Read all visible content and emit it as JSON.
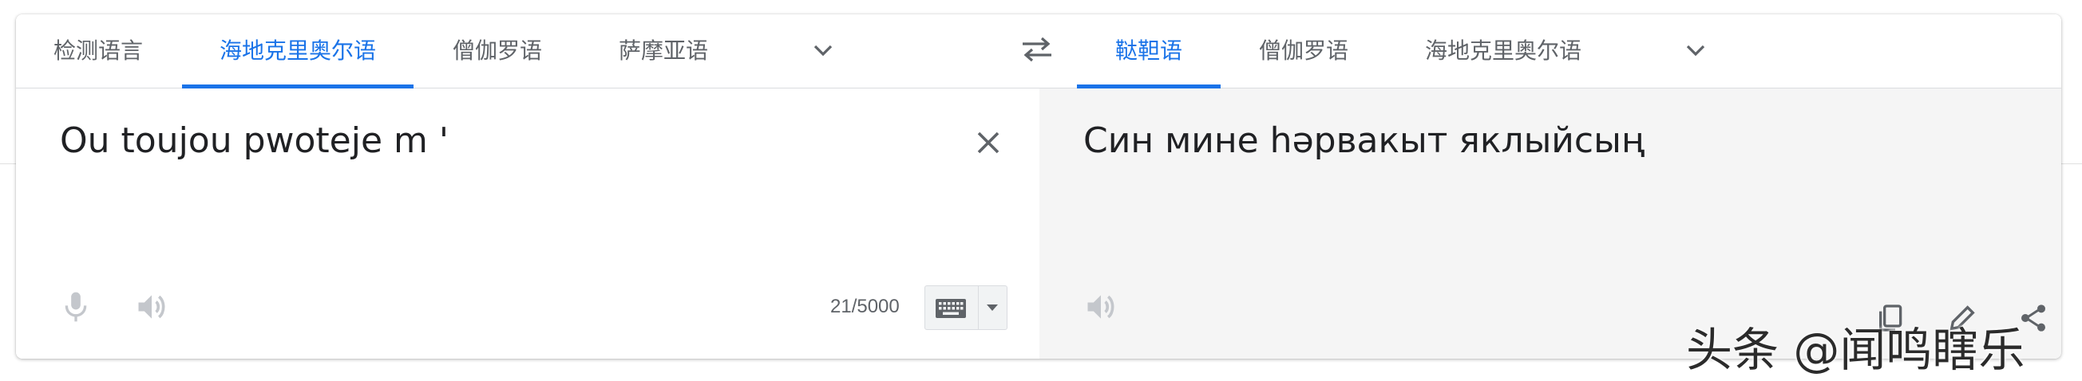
{
  "source_tabs": [
    {
      "label": "检测语言",
      "active": false
    },
    {
      "label": "海地克里奥尔语",
      "active": true
    },
    {
      "label": "僧伽罗语",
      "active": false
    },
    {
      "label": "萨摩亚语",
      "active": false
    }
  ],
  "target_tabs": [
    {
      "label": "鞑靼语",
      "active": true
    },
    {
      "label": "僧伽罗语",
      "active": false
    },
    {
      "label": "海地克里奥尔语",
      "active": false
    }
  ],
  "source": {
    "text": "Ou toujou pwoteje m '",
    "char_count": "21/5000"
  },
  "target": {
    "text": "Син мине һәрвакыт яклыйсың"
  },
  "watermark": "头条 @闻鸣瞎乐",
  "colors": {
    "accent": "#1a73e8",
    "target_bg": "#f5f5f5",
    "icon_gray": "#5f6368"
  },
  "icons": [
    "swap-languages-icon",
    "chevron-down-icon",
    "close-icon",
    "microphone-icon",
    "speaker-icon",
    "keyboard-icon",
    "copy-icon",
    "edit-icon",
    "share-icon"
  ]
}
